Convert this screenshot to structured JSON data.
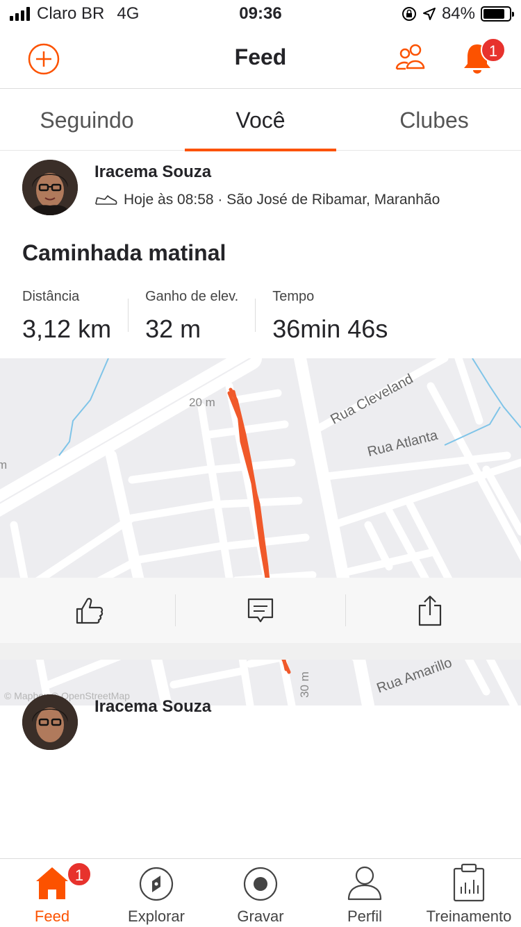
{
  "status": {
    "carrier": "Claro BR",
    "network": "4G",
    "time": "09:36",
    "battery": "84%",
    "battery_level": 0.84
  },
  "nav": {
    "title": "Feed",
    "notifications_count": "1"
  },
  "tabs": [
    {
      "label": "Seguindo"
    },
    {
      "label": "Você"
    },
    {
      "label": "Clubes"
    }
  ],
  "post": {
    "author": "Iracema Souza",
    "meta": "Hoje às 08:58 · São José de Ribamar, Maranhão",
    "title": "Caminhada matinal",
    "stats": [
      {
        "label": "Distância",
        "value": "3,12 km"
      },
      {
        "label": "Ganho de elev.",
        "value": "32 m"
      },
      {
        "label": "Tempo",
        "value": "36min 46s"
      }
    ],
    "map": {
      "streets": [
        "Rua Cleveland",
        "Rua Atlanta",
        "Rua Amarillo"
      ],
      "contour_labels": [
        "20 m",
        "30 m",
        "m"
      ],
      "credit": "© Mapbox © OpenStreetMap",
      "route_color": "#f0592a"
    }
  },
  "post2": {
    "author": "Iracema Souza"
  },
  "tabbar": {
    "items": [
      {
        "label": "Feed",
        "icon": "home-icon"
      },
      {
        "label": "Explorar",
        "icon": "compass-icon"
      },
      {
        "label": "Gravar",
        "icon": "record-icon"
      },
      {
        "label": "Perfil",
        "icon": "person-icon"
      },
      {
        "label": "Treinamento",
        "icon": "training-icon"
      }
    ],
    "feed_badge": "1"
  },
  "colors": {
    "accent": "#fc5200",
    "badge": "#e7322d"
  }
}
